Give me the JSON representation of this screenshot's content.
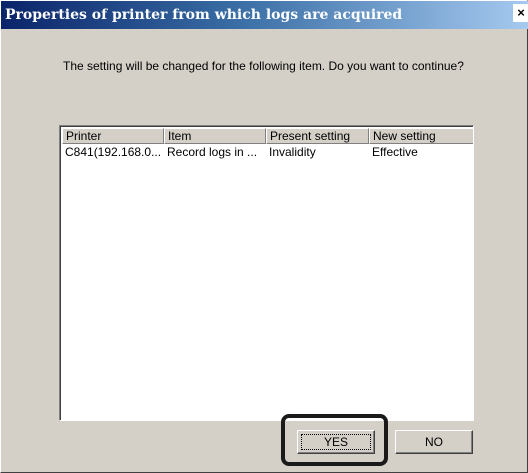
{
  "window": {
    "title": "Properties of printer from which logs are acquired",
    "close_label": "×"
  },
  "message": "The setting will be changed for the following item. Do you want to continue?",
  "table": {
    "columns": [
      "Printer",
      "Item",
      "Present setting",
      "New setting"
    ],
    "rows": [
      [
        "C841(192.168.0...",
        "Record logs in ...",
        "Invalidity",
        "Effective"
      ]
    ]
  },
  "buttons": {
    "yes": "YES",
    "no": "NO"
  },
  "colors": {
    "titlebar_start": "#0a246a",
    "titlebar_end": "#a6caf0",
    "dialog_background": "#d4d0c8",
    "highlight_border": "#1a1a1a"
  }
}
